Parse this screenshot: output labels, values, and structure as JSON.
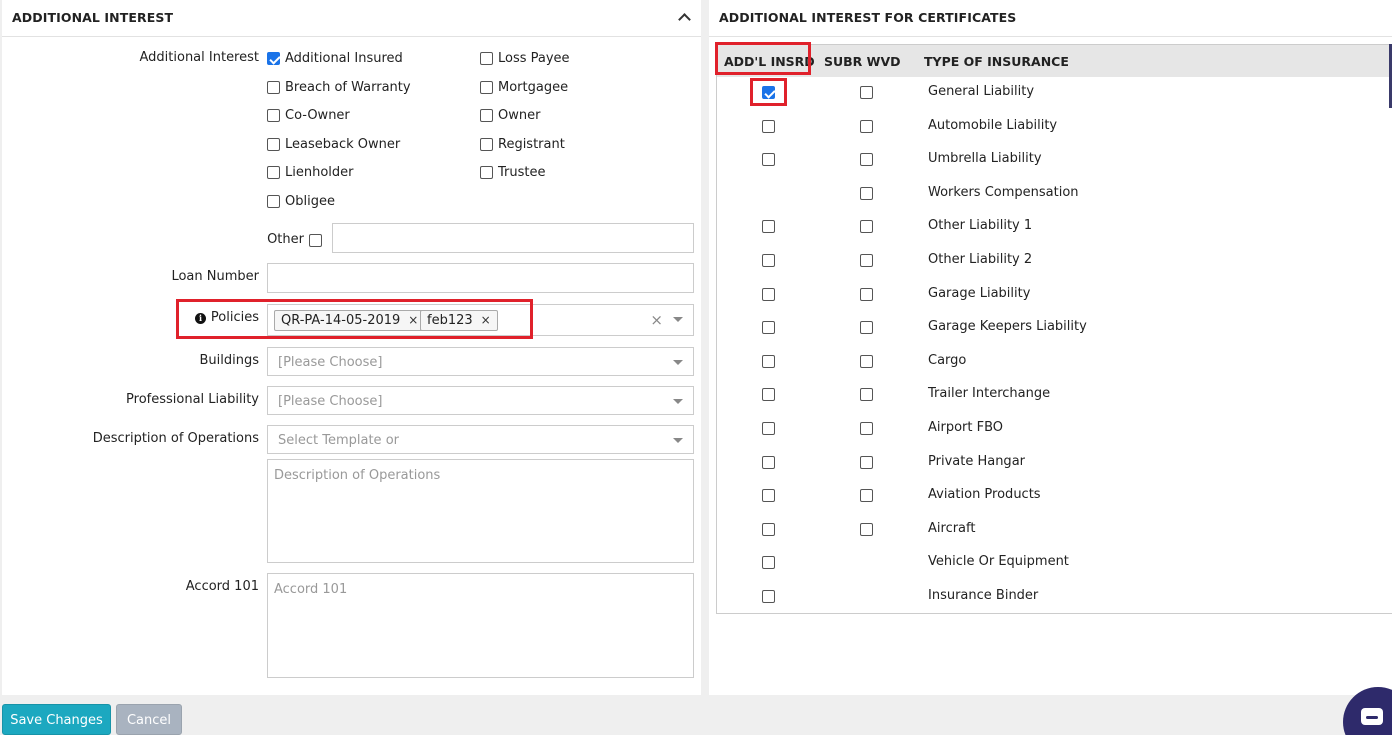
{
  "left_panel": {
    "title": "ADDITIONAL INTEREST",
    "additional_interest_label": "Additional Interest",
    "checkboxes_col1": [
      {
        "label": "Additional Insured",
        "checked": true
      },
      {
        "label": "Breach of Warranty",
        "checked": false
      },
      {
        "label": "Co-Owner",
        "checked": false
      },
      {
        "label": "Leaseback Owner",
        "checked": false
      },
      {
        "label": "Lienholder",
        "checked": false
      },
      {
        "label": "Obligee",
        "checked": false
      }
    ],
    "checkboxes_col2": [
      {
        "label": "Loss Payee",
        "checked": false
      },
      {
        "label": "Mortgagee",
        "checked": false
      },
      {
        "label": "Owner",
        "checked": false
      },
      {
        "label": "Registrant",
        "checked": false
      },
      {
        "label": "Trustee",
        "checked": false
      }
    ],
    "other_label": "Other",
    "other_value": "",
    "loan_number_label": "Loan Number",
    "loan_number_value": "",
    "policies_label": "Policies",
    "policies_tags": [
      "QR-PA-14-05-2019",
      "feb123"
    ],
    "tag_remove_glyph": "×",
    "clear_glyph": "×",
    "buildings_label": "Buildings",
    "buildings_placeholder": "[Please Choose]",
    "professional_liability_label": "Professional Liability",
    "professional_liability_placeholder": "[Please Choose]",
    "description_label": "Description of Operations",
    "description_template_placeholder": "Select Template or",
    "description_placeholder": "Description of Operations",
    "accord_label": "Accord 101",
    "accord_placeholder": "Accord 101"
  },
  "right_panel": {
    "title": "ADDITIONAL INTEREST FOR CERTIFICATES",
    "columns": [
      "ADD'L INSRD",
      "SUBR WVD",
      "TYPE OF INSURANCE"
    ],
    "rows": [
      {
        "type": "General Liability",
        "addl": true,
        "subr": false,
        "has_addl": true,
        "has_subr": true
      },
      {
        "type": "Automobile Liability",
        "addl": false,
        "subr": false,
        "has_addl": true,
        "has_subr": true
      },
      {
        "type": "Umbrella Liability",
        "addl": false,
        "subr": false,
        "has_addl": true,
        "has_subr": true
      },
      {
        "type": "Workers Compensation",
        "addl": false,
        "subr": false,
        "has_addl": false,
        "has_subr": true
      },
      {
        "type": "Other Liability 1",
        "addl": false,
        "subr": false,
        "has_addl": true,
        "has_subr": true
      },
      {
        "type": "Other Liability 2",
        "addl": false,
        "subr": false,
        "has_addl": true,
        "has_subr": true
      },
      {
        "type": "Garage Liability",
        "addl": false,
        "subr": false,
        "has_addl": true,
        "has_subr": true
      },
      {
        "type": "Garage Keepers Liability",
        "addl": false,
        "subr": false,
        "has_addl": true,
        "has_subr": true
      },
      {
        "type": "Cargo",
        "addl": false,
        "subr": false,
        "has_addl": true,
        "has_subr": true
      },
      {
        "type": "Trailer Interchange",
        "addl": false,
        "subr": false,
        "has_addl": true,
        "has_subr": true
      },
      {
        "type": "Airport FBO",
        "addl": false,
        "subr": false,
        "has_addl": true,
        "has_subr": true
      },
      {
        "type": "Private Hangar",
        "addl": false,
        "subr": false,
        "has_addl": true,
        "has_subr": true
      },
      {
        "type": "Aviation Products",
        "addl": false,
        "subr": false,
        "has_addl": true,
        "has_subr": true
      },
      {
        "type": "Aircraft",
        "addl": false,
        "subr": false,
        "has_addl": true,
        "has_subr": true
      },
      {
        "type": "Vehicle Or Equipment",
        "addl": false,
        "subr": false,
        "has_addl": true,
        "has_subr": false
      },
      {
        "type": "Insurance Binder",
        "addl": false,
        "subr": false,
        "has_addl": true,
        "has_subr": false
      }
    ]
  },
  "footer": {
    "save_label": "Save Changes",
    "cancel_label": "Cancel"
  },
  "colors": {
    "accent": "#1ca8c0",
    "highlight": "#e0212b",
    "checkbox_checked": "#1a73e8"
  }
}
